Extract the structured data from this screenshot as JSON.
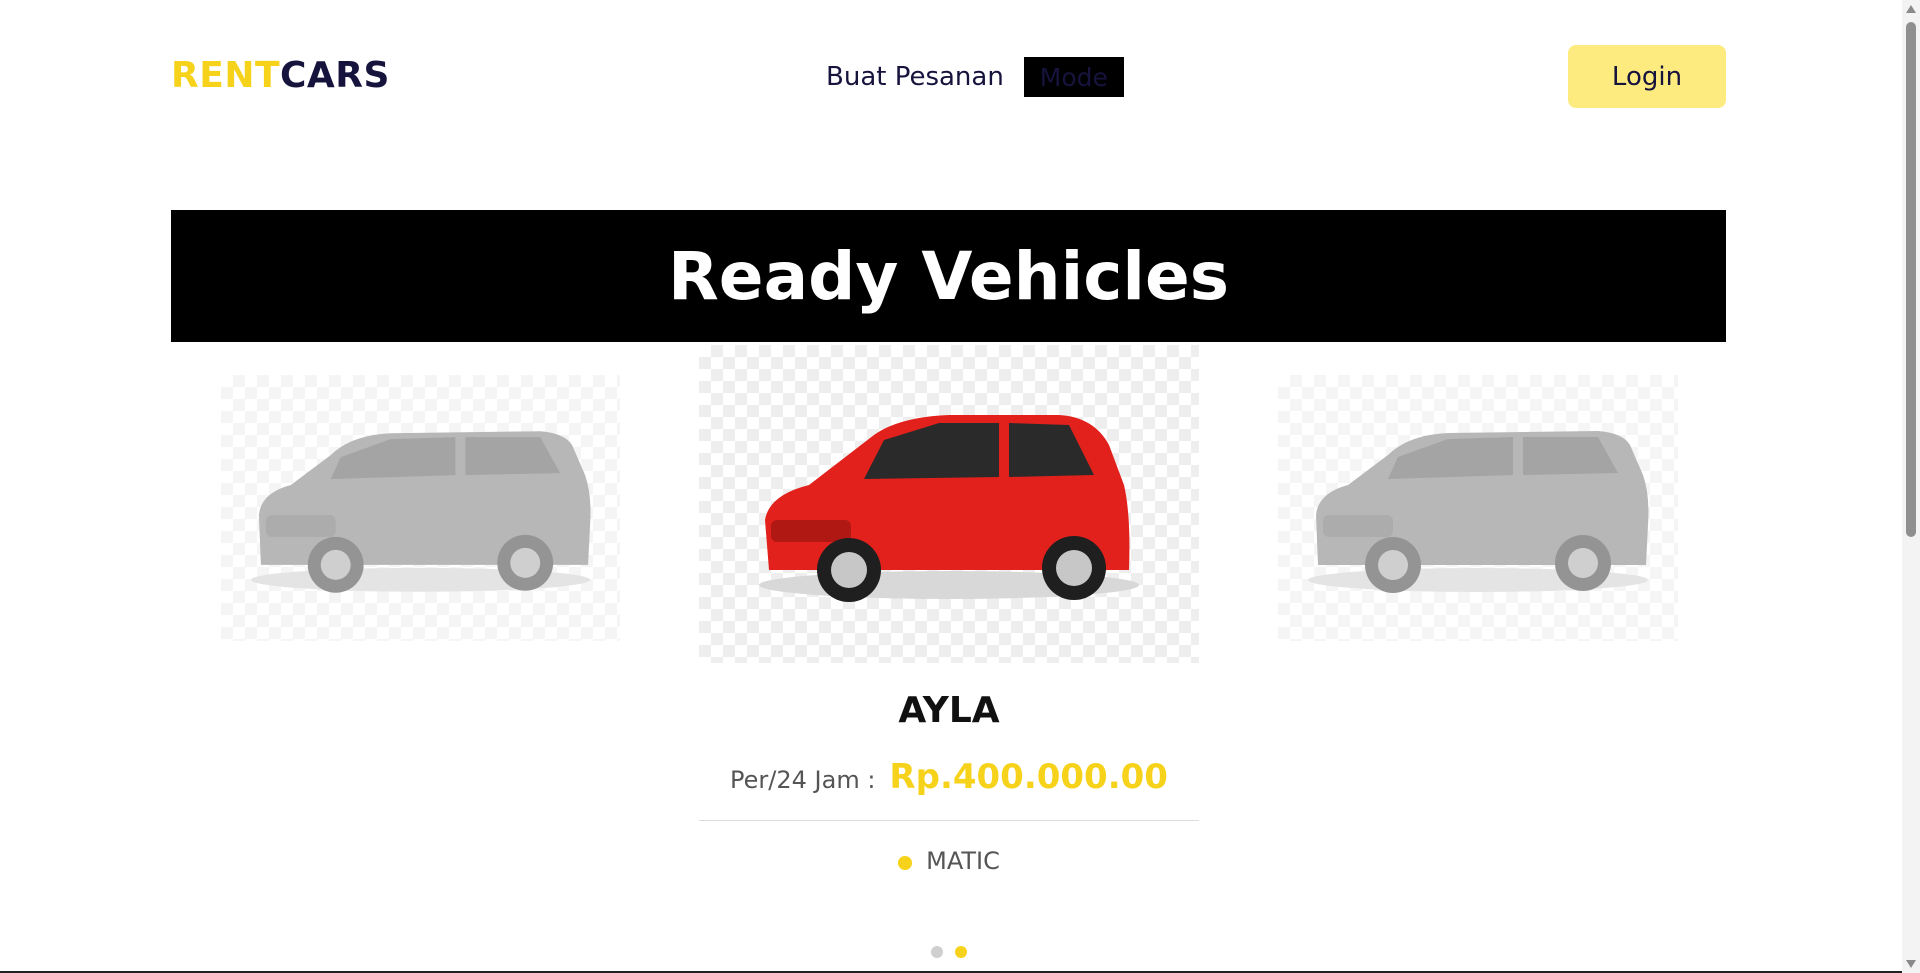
{
  "header": {
    "logo_part1": "RENT",
    "logo_part2": "CARS",
    "nav_order": "Buat Pesanan",
    "mode_label": "Mode",
    "login_label": "Login"
  },
  "banner": {
    "title_word1": "Ready",
    "title_word2": "Vehicles"
  },
  "carousel": {
    "active": {
      "name": "AYLA",
      "price_label": "Per/24 Jam :",
      "price": "Rp.400.000.00",
      "transmission": "MATIC"
    },
    "pages": 2,
    "active_page": 2
  },
  "colors": {
    "brand_yellow": "#f7d21a",
    "brand_navy": "#16133d",
    "login_bg": "#fdeb7f",
    "banner_bg": "#000000",
    "car_red": "#e3211c",
    "car_grey": "#8a8a8a"
  }
}
